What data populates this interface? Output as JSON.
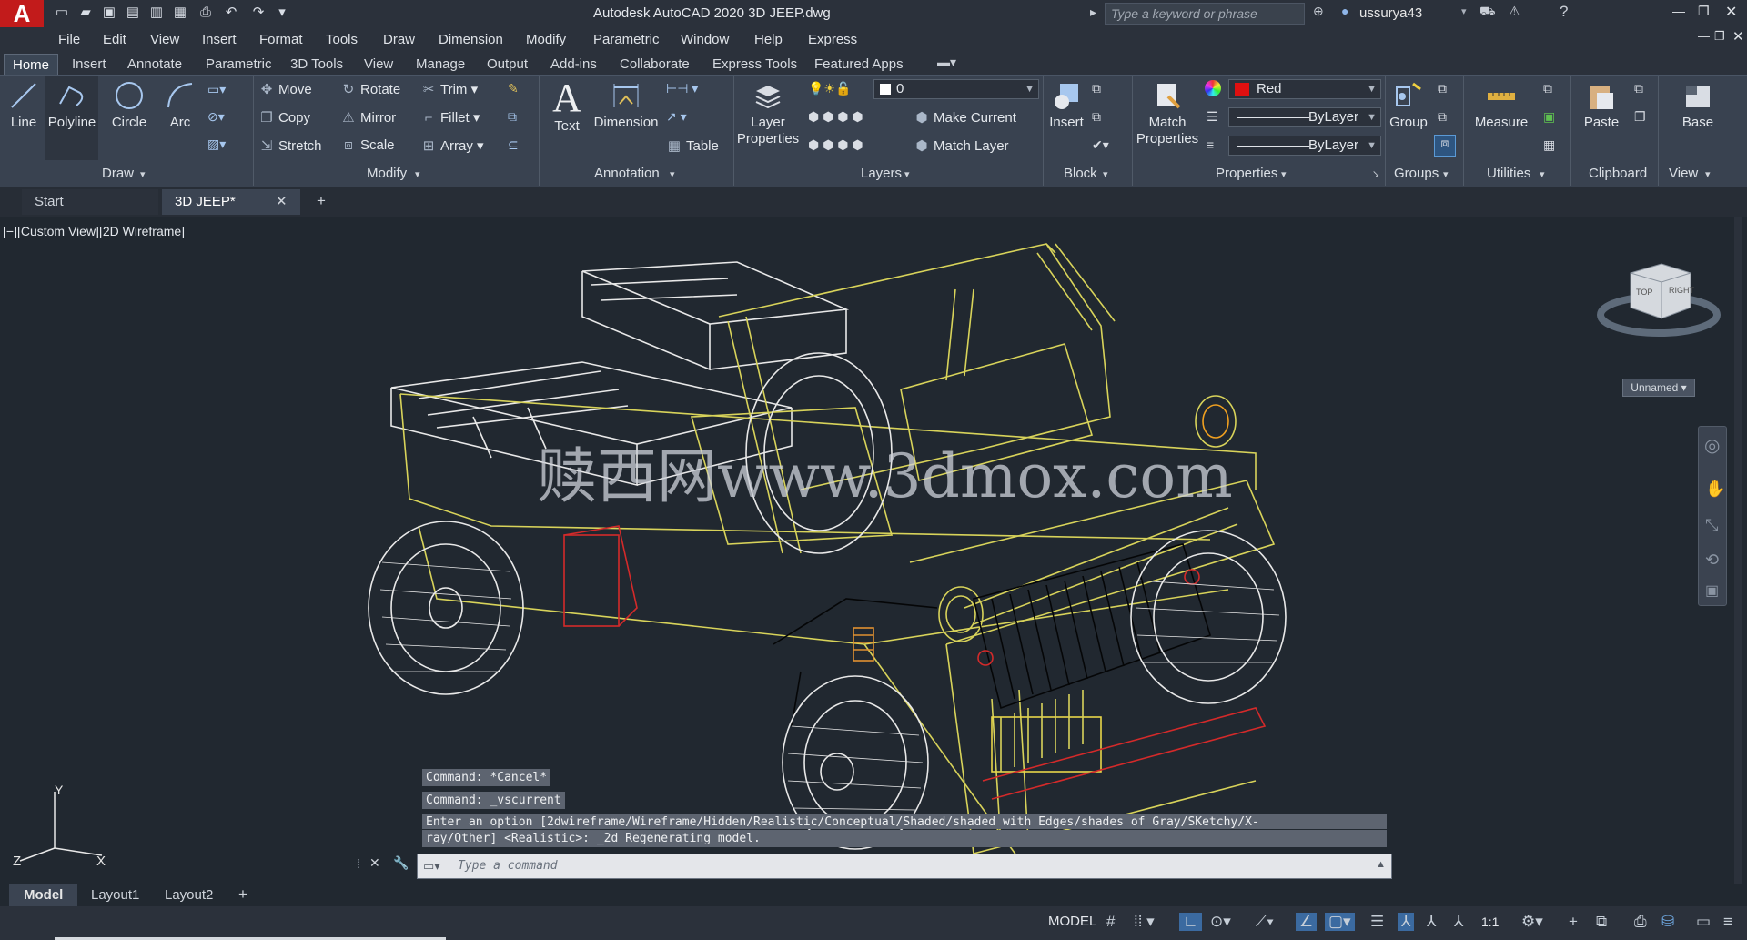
{
  "window": {
    "title": "Autodesk AutoCAD 2020    3D JEEP.dwg",
    "search_placeholder": "Type a keyword or phrase",
    "user": "ussurya43"
  },
  "menu": [
    "File",
    "Edit",
    "View",
    "Insert",
    "Format",
    "Tools",
    "Draw",
    "Dimension",
    "Modify",
    "Parametric",
    "Window",
    "Help",
    "Express"
  ],
  "ribbon_tabs": [
    "Home",
    "Insert",
    "Annotate",
    "Parametric",
    "3D Tools",
    "View",
    "Manage",
    "Output",
    "Add-ins",
    "Collaborate",
    "Express Tools",
    "Featured Apps"
  ],
  "draw": {
    "line": "Line",
    "polyline": "Polyline",
    "circle": "Circle",
    "arc": "Arc",
    "label": "Draw"
  },
  "modify": {
    "move": "Move",
    "rotate": "Rotate",
    "trim": "Trim",
    "copy": "Copy",
    "mirror": "Mirror",
    "fillet": "Fillet",
    "stretch": "Stretch",
    "scale": "Scale",
    "array": "Array",
    "label": "Modify"
  },
  "annotation": {
    "text": "Text",
    "dimension": "Dimension",
    "table": "Table",
    "label": "Annotation"
  },
  "layers": {
    "layer_properties": "Layer Properties",
    "current_layer": "0",
    "make_current": "Make Current",
    "match_layer": "Match Layer",
    "label": "Layers"
  },
  "block": {
    "insert": "Insert",
    "label": "Block"
  },
  "properties": {
    "match": "Match Properties",
    "color": "Red",
    "linetype": "ByLayer",
    "lineweight": "ByLayer",
    "label": "Properties"
  },
  "groups": {
    "group": "Group",
    "label": "Groups"
  },
  "utilities": {
    "measure": "Measure",
    "label": "Utilities"
  },
  "clipboard": {
    "paste": "Paste",
    "label": "Clipboard"
  },
  "view": {
    "base": "Base",
    "label": "View"
  },
  "doc_tabs": [
    "Start",
    "3D JEEP*"
  ],
  "viewport": {
    "label": "[−][Custom View][2D Wireframe]",
    "watermark": "赎西网www.3dmox.com",
    "viewcube_top": "TOP",
    "viewcube_right": "RIGHT",
    "named_view": "Unnamed",
    "ucs_x": "X",
    "ucs_y": "Y",
    "ucs_z": "Z"
  },
  "command": {
    "history1": "Command: *Cancel*",
    "history2": "Command: _vscurrent",
    "history3a": "Enter an option [2dwireframe/Wireframe/Hidden/Realistic/Conceptual/Shaded/shaded with Edges/shades of Gray/SKetchy/X-",
    "history3b": "ray/Other] <Realistic>: _2d Regenerating model.",
    "placeholder": "Type a command"
  },
  "layout_tabs": [
    "Model",
    "Layout1",
    "Layout2"
  ],
  "status": {
    "model": "MODEL",
    "scale": "1:1"
  },
  "colors": {
    "accent": "#c21b1b",
    "wire_yellow": "#d8d35a",
    "wire_white": "#e8e8e8",
    "wire_red": "#d42a2a"
  }
}
